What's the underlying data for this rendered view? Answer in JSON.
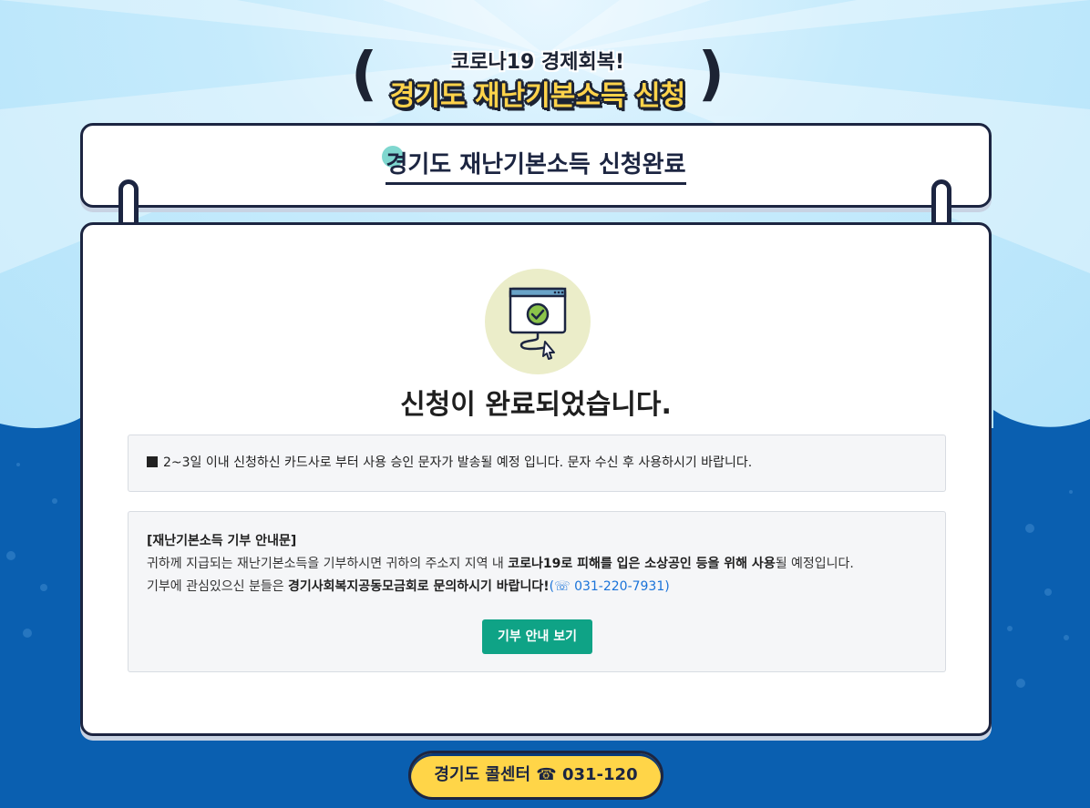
{
  "banner": {
    "subtitle": "코로나19 경제회복!",
    "title": "경기도 재난기본소득 신청"
  },
  "header": {
    "title": "경기도 재난기본소득 신청완료"
  },
  "main": {
    "icon": "browser-check-icon",
    "done_message": "신청이 완료되었습니다.",
    "notice": "2~3일 이내 신청하신 카드사로 부터 사용 승인 문자가 발송될 예정 입니다. 문자 수신 후 사용하시기 바랍니다.",
    "donation": {
      "heading": "[재난기본소득 기부 안내문]",
      "line1_pre": "귀하께 지급되는 재난기본소득을 기부하시면 귀하의 주소지 지역 내 ",
      "line1_bold": "코로나19로 피해를 입은 소상공인 등을 위해 사용",
      "line1_post": "될 예정입니다.",
      "line2_pre": "기부에 관심있으신 분들은 ",
      "line2_bold": "경기사회복지공동모금회로 문의하시기 바랍니다!",
      "line2_phone": "(☏ 031-220-7931)",
      "button_label": "기부 안내 보기"
    }
  },
  "footer": {
    "call_center": "경기도 콜센터 ☎ 031-120"
  },
  "colors": {
    "navy": "#1c2541",
    "accent_yellow": "#ffd548",
    "button_green": "#0fa386",
    "sea_blue": "#0a5fb0",
    "phone_link": "#1a73d9"
  }
}
